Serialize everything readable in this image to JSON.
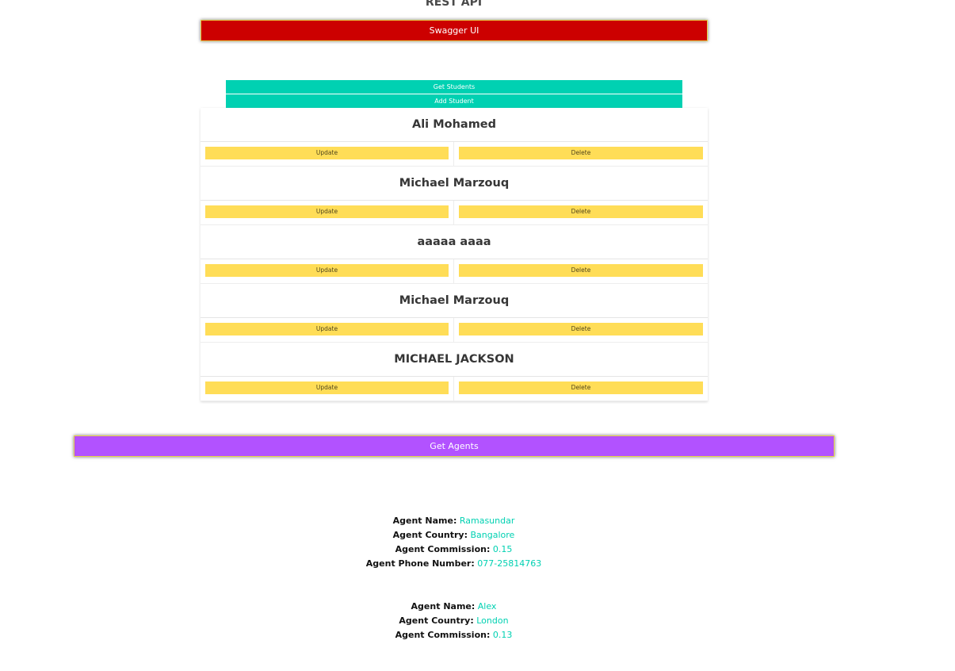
{
  "page": {
    "title": "REST API"
  },
  "buttons": {
    "swagger": "Swagger UI",
    "get_students": "Get Students",
    "add_student": "Add Student",
    "get_agents": "Get Agents"
  },
  "students": [
    {
      "name": "Ali Mohamed",
      "update_label": "Update",
      "delete_label": "Delete"
    },
    {
      "name": "Michael Marzouq",
      "update_label": "Update",
      "delete_label": "Delete"
    },
    {
      "name": "aaaaa aaaa",
      "update_label": "Update",
      "delete_label": "Delete"
    },
    {
      "name": "Michael Marzouq",
      "update_label": "Update",
      "delete_label": "Delete"
    },
    {
      "name": "MICHAEL JACKSON",
      "update_label": "Update",
      "delete_label": "Delete"
    }
  ],
  "agent_labels": {
    "name": "Agent Name:",
    "country": "Agent Country:",
    "commission": "Agent Commission:",
    "phone": "Agent Phone Number:"
  },
  "agents": [
    {
      "name": "Ramasundar",
      "country": "Bangalore",
      "commission": "0.15",
      "phone": "077-25814763"
    },
    {
      "name": "Alex",
      "country": "London",
      "commission": "0.13"
    }
  ],
  "colors": {
    "swagger_button": "#cc0000",
    "primary_teal": "#00d1b2",
    "warning_yellow": "#ffdd57",
    "agents_button": "#b252ff"
  }
}
